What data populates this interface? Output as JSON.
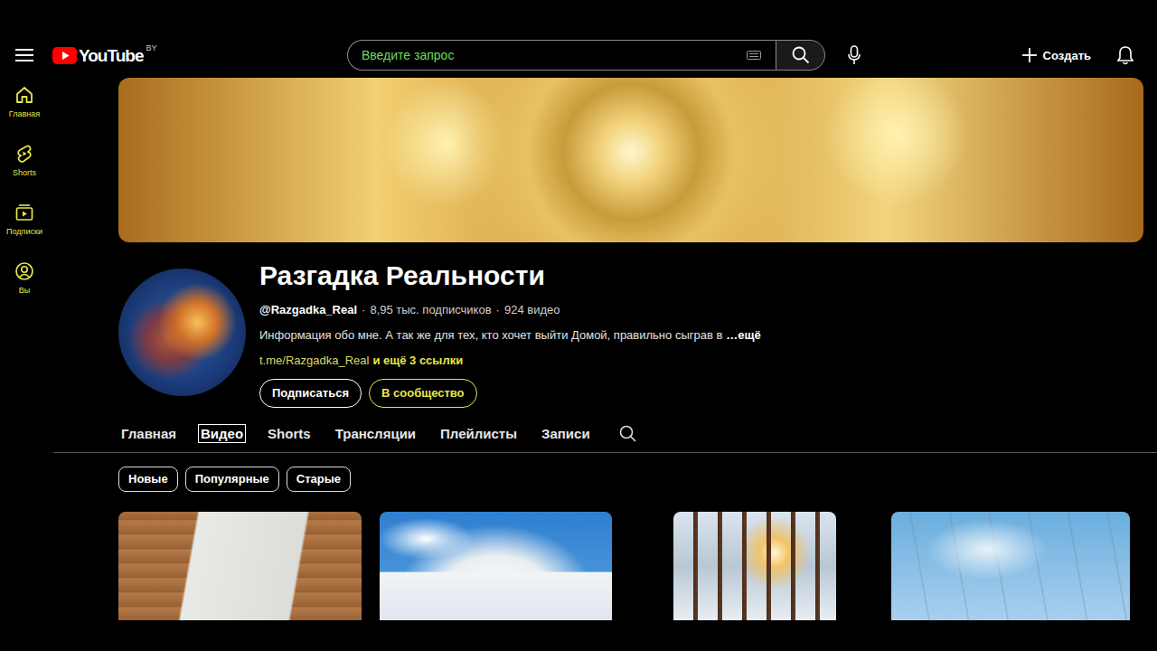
{
  "topbar": {
    "logo": "YouTube",
    "region": "BY",
    "search": {
      "placeholder": "Введите запрос"
    },
    "create": "Создать"
  },
  "sidebar": {
    "items": [
      {
        "label": "Главная",
        "kind": "home"
      },
      {
        "label": "Shorts",
        "kind": "shorts"
      },
      {
        "label": "Подписки",
        "kind": "subscriptions"
      },
      {
        "label": "Вы",
        "kind": "you"
      }
    ]
  },
  "channel": {
    "name": "Разгадка Реальности",
    "handle": "@Razgadka_Real",
    "separator": "·",
    "subscribers": "8,95 тыс. подписчиков",
    "videos": "924 видео",
    "description": "Информация обо мне. А так же для тех, кто хочет выйти Домой, правильно сыграв в",
    "more": "…ещё",
    "link": "t.me/Razgadka_Real",
    "more_links": "и ещё 3 ссылки",
    "buttons": [
      {
        "label": "Подписаться",
        "kind": "subscribe"
      },
      {
        "label": "В сообщество",
        "kind": "community"
      }
    ]
  },
  "tabs": [
    {
      "label": "Главная",
      "selected": false
    },
    {
      "label": "Видео",
      "selected": true
    },
    {
      "label": "Shorts",
      "selected": false
    },
    {
      "label": "Трансляции",
      "selected": false
    },
    {
      "label": "Плейлисты",
      "selected": false
    },
    {
      "label": "Записи",
      "selected": false
    }
  ],
  "filters": [
    "Новые",
    "Популярные",
    "Старые"
  ],
  "videos": [
    {
      "kind": "paper"
    },
    {
      "kind": "snow"
    },
    {
      "kind": "forest"
    },
    {
      "kind": "sky"
    }
  ]
}
